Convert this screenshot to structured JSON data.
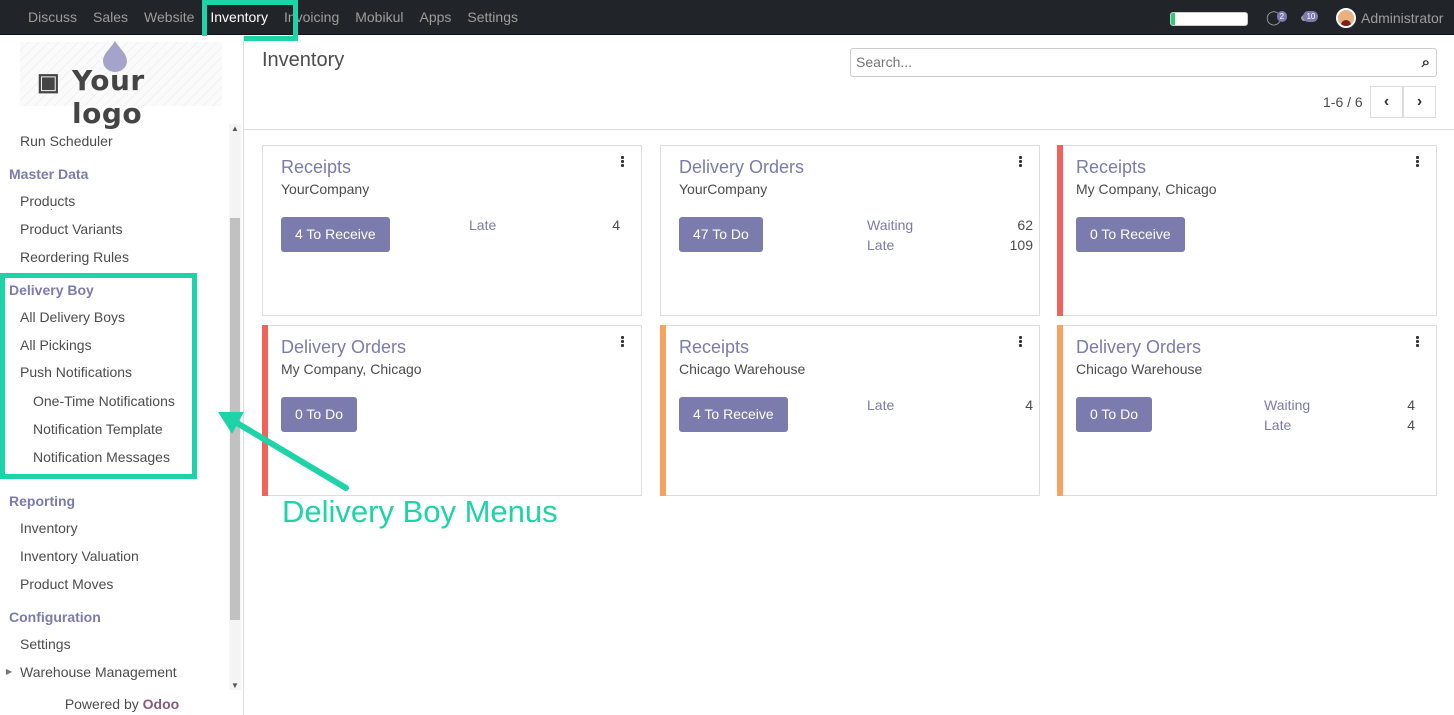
{
  "topbar": {
    "menu": [
      "Discuss",
      "Sales",
      "Website",
      "Inventory",
      "Invoicing",
      "Mobikul",
      "Apps",
      "Settings"
    ],
    "active": "Inventory",
    "progress": 0.05,
    "chat_count": "2",
    "message_count": "10",
    "user": "Administrator",
    "icons": {
      "chat": "chat-bubble-icon",
      "messages": "comments-icon"
    }
  },
  "sidebar": {
    "logo_text": "Your logo",
    "items": [
      {
        "type": "item",
        "label": "Run Scheduler"
      },
      {
        "type": "head",
        "label": "Master Data"
      },
      {
        "type": "item",
        "label": "Products"
      },
      {
        "type": "item",
        "label": "Product Variants"
      },
      {
        "type": "item",
        "label": "Reordering Rules"
      },
      {
        "type": "head",
        "label": "Delivery Boy"
      },
      {
        "type": "item",
        "label": "All Delivery Boys"
      },
      {
        "type": "item",
        "label": "All Pickings"
      },
      {
        "type": "item",
        "label": "Push Notifications"
      },
      {
        "type": "sub",
        "label": "One-Time Notifications"
      },
      {
        "type": "sub",
        "label": "Notification Template"
      },
      {
        "type": "sub",
        "label": "Notification Messages"
      },
      {
        "type": "head",
        "label": "Reporting"
      },
      {
        "type": "item",
        "label": "Inventory"
      },
      {
        "type": "item",
        "label": "Inventory Valuation"
      },
      {
        "type": "item",
        "label": "Product Moves"
      },
      {
        "type": "head",
        "label": "Configuration"
      },
      {
        "type": "item",
        "label": "Settings"
      },
      {
        "type": "item",
        "label": "Warehouse Management"
      }
    ],
    "powered_by": "Powered by",
    "powered_brand": "Odoo"
  },
  "control": {
    "title": "Inventory",
    "search_placeholder": "Search...",
    "pager": "1-6 / 6"
  },
  "cards": [
    {
      "title": "Receipts",
      "company": "YourCompany",
      "button": "4 To Receive",
      "stripe": "",
      "stats": [
        {
          "label": "Late",
          "value": "4"
        }
      ]
    },
    {
      "title": "Delivery Orders",
      "company": "YourCompany",
      "button": "47 To Do",
      "stripe": "",
      "stats": [
        {
          "label": "Waiting",
          "value": "62"
        },
        {
          "label": "Late",
          "value": "109"
        }
      ]
    },
    {
      "title": "Receipts",
      "company": "My Company, Chicago",
      "button": "0 To Receive",
      "stripe": "#f0625b",
      "stats": []
    },
    {
      "title": "Delivery Orders",
      "company": "My Company, Chicago",
      "button": "0 To Do",
      "stripe": "#f0625b",
      "stats": []
    },
    {
      "title": "Receipts",
      "company": "Chicago Warehouse",
      "button": "4 To Receive",
      "stripe": "#f7a25e",
      "stats": [
        {
          "label": "Late",
          "value": "4"
        }
      ]
    },
    {
      "title": "Delivery Orders",
      "company": "Chicago Warehouse",
      "button": "0 To Do",
      "stripe": "#f7a25e",
      "stats": [
        {
          "label": "Waiting",
          "value": "4"
        },
        {
          "label": "Late",
          "value": "4"
        }
      ]
    }
  ],
  "annotation": "Delivery Boy Menus",
  "colors": {
    "accent": "#7c7bad",
    "highlight": "#1fd3a8",
    "brand": "#875a7b"
  }
}
